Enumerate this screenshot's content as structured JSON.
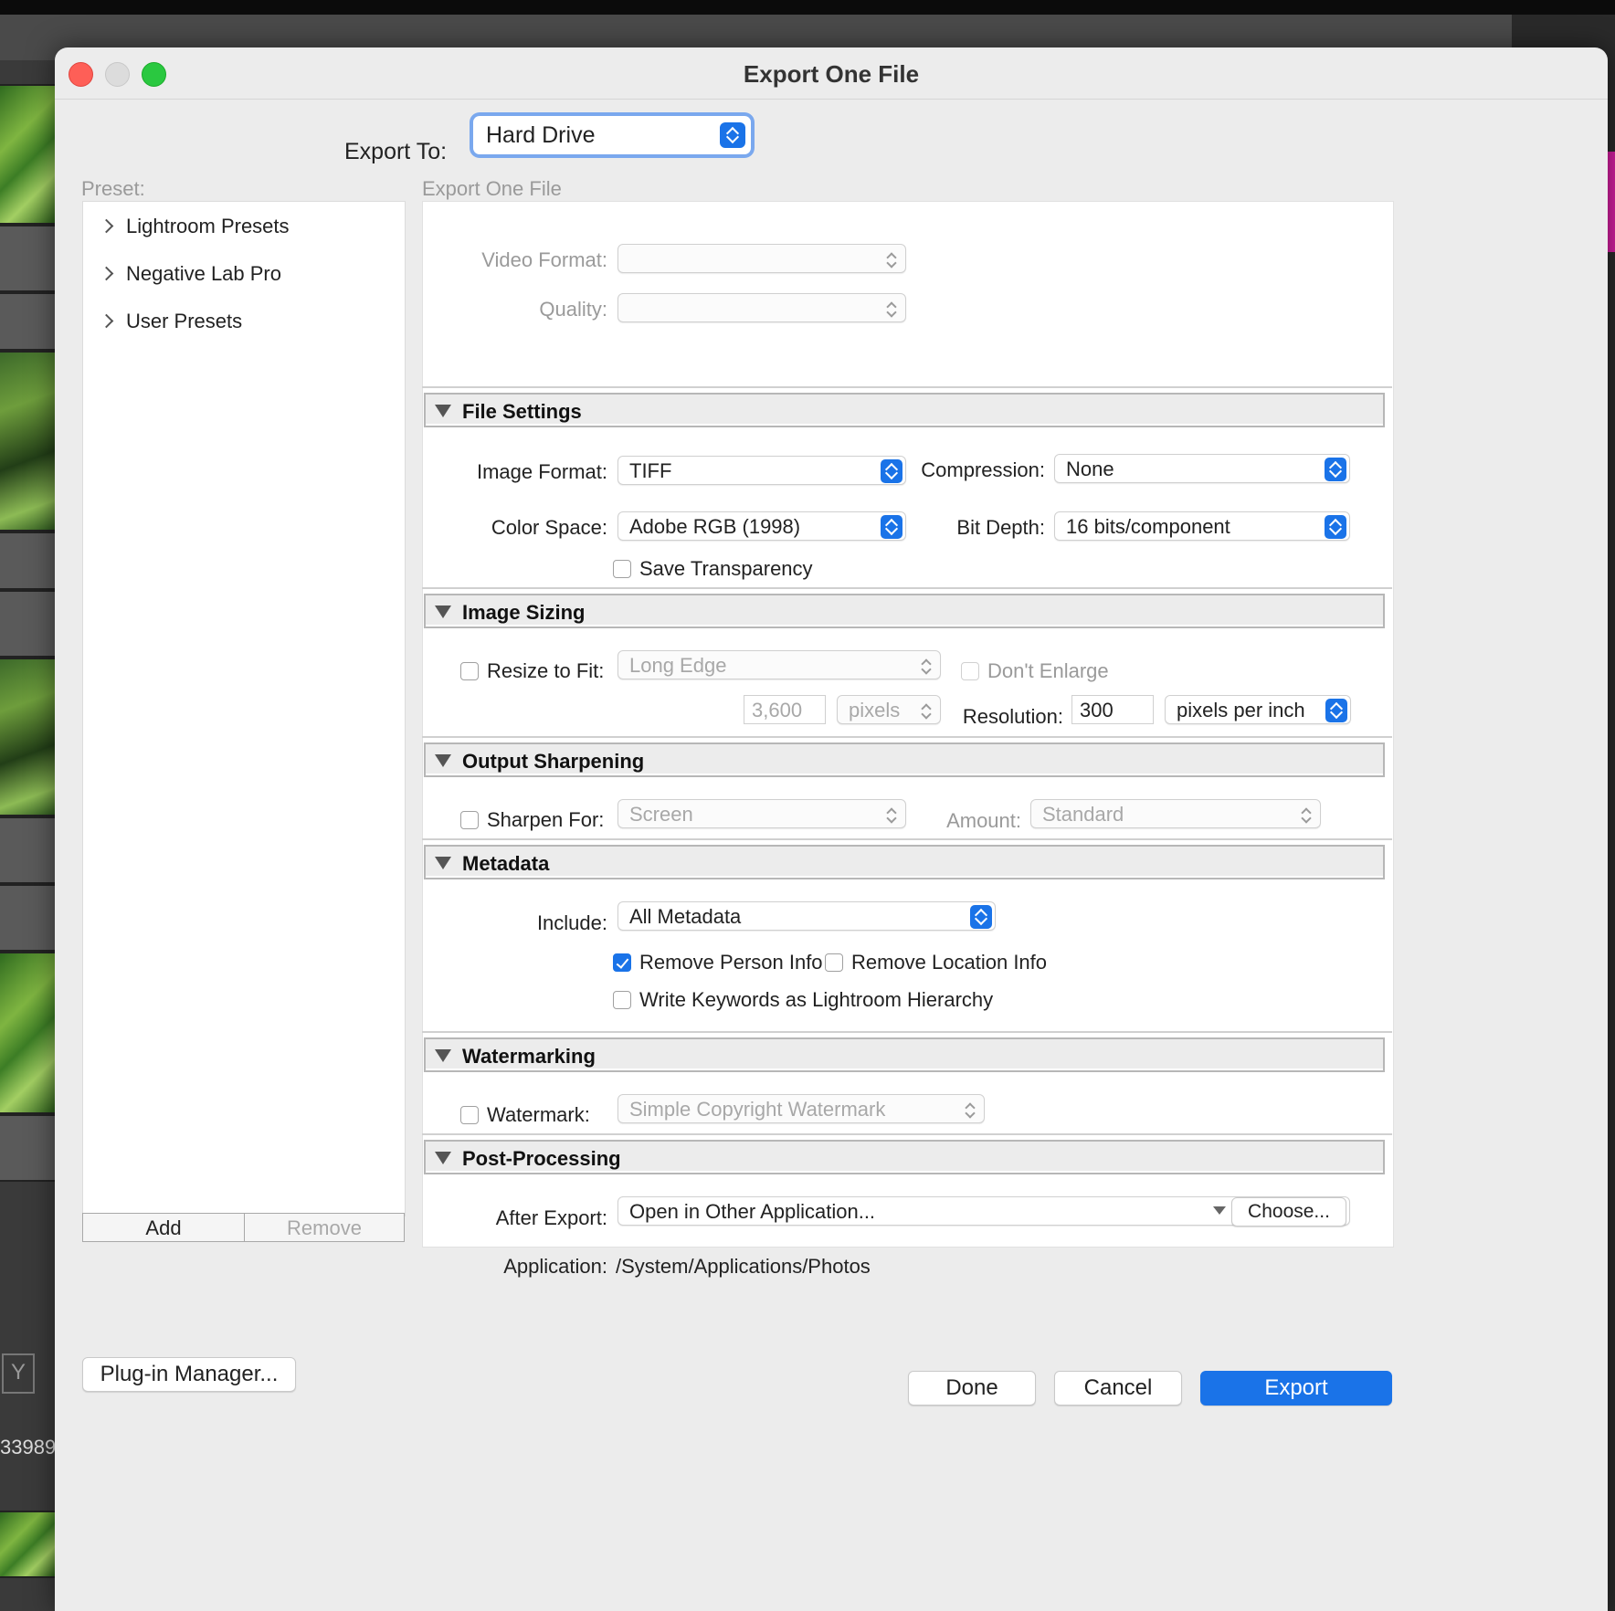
{
  "background": {
    "counter_text": "33989",
    "key_label": "Y"
  },
  "dialog": {
    "title": "Export One File",
    "export_to": {
      "label": "Export To:",
      "value": "Hard Drive"
    },
    "preset": {
      "label": "Preset:",
      "items": [
        "Lightroom Presets",
        "Negative Lab Pro",
        "User Presets"
      ],
      "add_label": "Add",
      "remove_label": "Remove"
    },
    "settings_heading": "Export One File",
    "video": {
      "video_format_label": "Video Format:",
      "video_format_value": "",
      "quality_label": "Quality:",
      "quality_value": ""
    },
    "file_settings": {
      "title": "File Settings",
      "image_format_label": "Image Format:",
      "image_format_value": "TIFF",
      "compression_label": "Compression:",
      "compression_value": "None",
      "color_space_label": "Color Space:",
      "color_space_value": "Adobe RGB (1998)",
      "bit_depth_label": "Bit Depth:",
      "bit_depth_value": "16 bits/component",
      "save_transparency_label": "Save Transparency",
      "save_transparency_checked": false
    },
    "image_sizing": {
      "title": "Image Sizing",
      "resize_label": "Resize to Fit:",
      "resize_checked": false,
      "resize_value": "Long Edge",
      "dont_enlarge_label": "Don't Enlarge",
      "size_value": "3,600",
      "size_unit": "pixels",
      "resolution_label": "Resolution:",
      "resolution_value": "300",
      "resolution_unit": "pixels per inch"
    },
    "output_sharpening": {
      "title": "Output Sharpening",
      "sharpen_label": "Sharpen For:",
      "sharpen_checked": false,
      "sharpen_value": "Screen",
      "amount_label": "Amount:",
      "amount_value": "Standard"
    },
    "metadata": {
      "title": "Metadata",
      "include_label": "Include:",
      "include_value": "All Metadata",
      "remove_person_label": "Remove Person Info",
      "remove_person_checked": true,
      "remove_location_label": "Remove Location Info",
      "remove_location_checked": false,
      "keywords_label": "Write Keywords as Lightroom Hierarchy",
      "keywords_checked": false
    },
    "watermarking": {
      "title": "Watermarking",
      "watermark_label": "Watermark:",
      "watermark_checked": false,
      "watermark_value": "Simple Copyright Watermark"
    },
    "post_processing": {
      "title": "Post-Processing",
      "after_export_label": "After Export:",
      "after_export_value": "Open in Other Application...",
      "application_label": "Application:",
      "application_value": "/System/Applications/Photos",
      "choose_label": "Choose..."
    },
    "buttons": {
      "plugin_manager": "Plug-in Manager...",
      "done": "Done",
      "cancel": "Cancel",
      "export": "Export"
    },
    "colors": {
      "accent": "#1a73e8",
      "close": "#fe5f57",
      "zoom": "#2ac840"
    }
  }
}
